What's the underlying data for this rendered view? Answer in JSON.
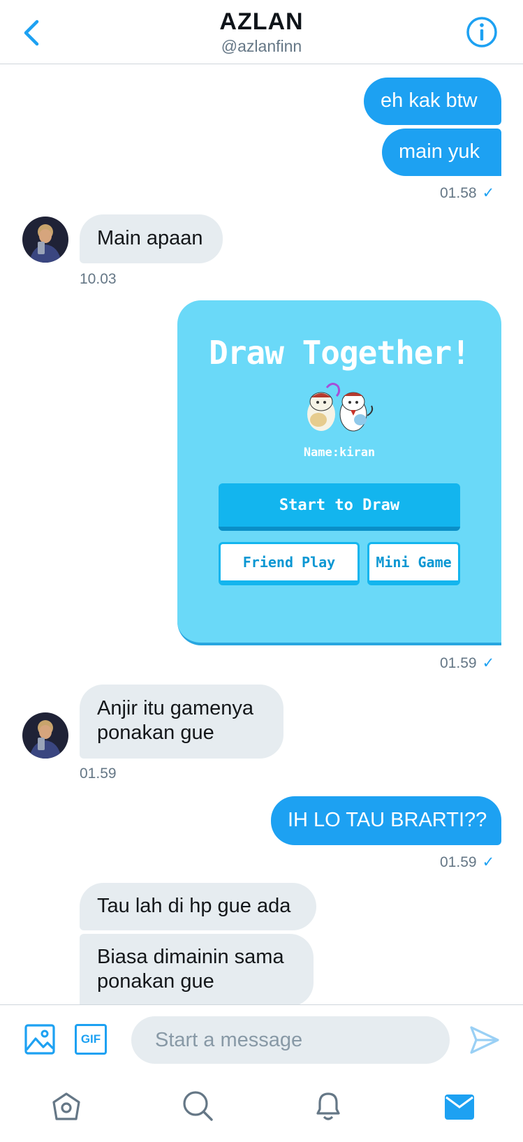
{
  "header": {
    "title": "AZLAN",
    "handle": "@azlanfinn"
  },
  "messages": {
    "m1": "eh kak btw",
    "m2": "main yuk",
    "t1": "01.58",
    "m3": "Main apaan",
    "t2": "10.03",
    "t3": "01.59",
    "m4a": "Anjir itu gamenya",
    "m4b": "ponakan gue",
    "t4": "01.59",
    "m5": "IH LO TAU BRARTI??",
    "t5": "01.59",
    "m6": "Tau lah di hp gue ada",
    "m7a": "Biasa dimainin sama",
    "m7b": "ponakan gue",
    "check": "✓"
  },
  "game_card": {
    "title": "Draw Together!",
    "name_label": "Name:kiran",
    "start_button": "Start to Draw",
    "friend_button": "Friend Play",
    "mini_button": "Mini Game"
  },
  "composer": {
    "placeholder": "Start a message",
    "gif_label": "GIF"
  },
  "colors": {
    "accent": "#1da1f2",
    "incoming": "#e6ecf0",
    "card": "#6ad9f8"
  },
  "icons": [
    "back-chevron-icon",
    "info-icon",
    "image-icon",
    "gif-icon",
    "send-icon",
    "home-icon",
    "search-icon",
    "bell-icon",
    "mail-icon"
  ]
}
